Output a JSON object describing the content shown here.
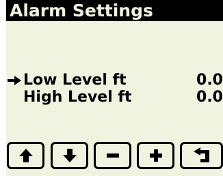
{
  "title": "Alarm Settings",
  "colors": {
    "background": "#f1f3e1",
    "title_bar": "#000000",
    "text": "#000000"
  },
  "menu": {
    "items": [
      {
        "label": "Low Level ft",
        "value": "0.0",
        "selected": true
      },
      {
        "label": "High Level ft",
        "value": "0.0",
        "selected": false
      }
    ]
  },
  "softkeys": [
    {
      "icon": "arrow-up-icon"
    },
    {
      "icon": "arrow-down-icon"
    },
    {
      "icon": "minus-icon"
    },
    {
      "icon": "plus-icon"
    },
    {
      "icon": "back-return-icon"
    }
  ]
}
